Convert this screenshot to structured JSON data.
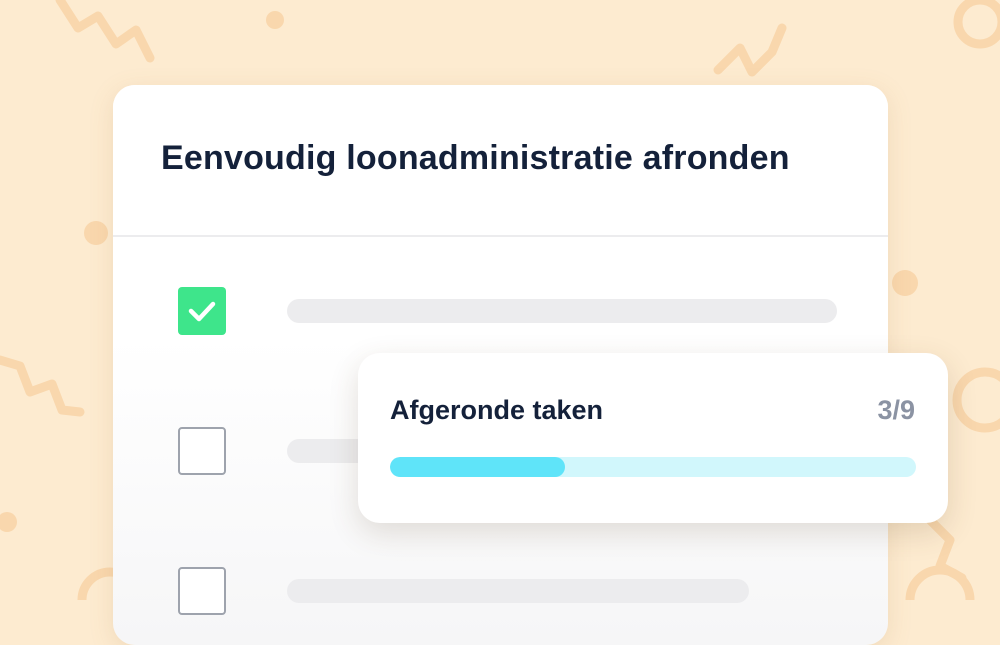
{
  "card": {
    "title": "Eenvoudig loonadministratie afronden"
  },
  "tasks": [
    {
      "checked": true
    },
    {
      "checked": false
    },
    {
      "checked": false
    }
  ],
  "progress": {
    "label": "Afgeronde taken",
    "count": "3/9",
    "fraction": 0.3333
  },
  "colors": {
    "background": "#fdebd0",
    "decoration": "#f9d7ad",
    "title": "#14213a",
    "check_green": "#3ee58b",
    "progress_fill": "#5fe4f9",
    "progress_track": "#d1f7fc",
    "count_gray": "#8b93a3"
  },
  "icons": {
    "check": "check-icon"
  }
}
